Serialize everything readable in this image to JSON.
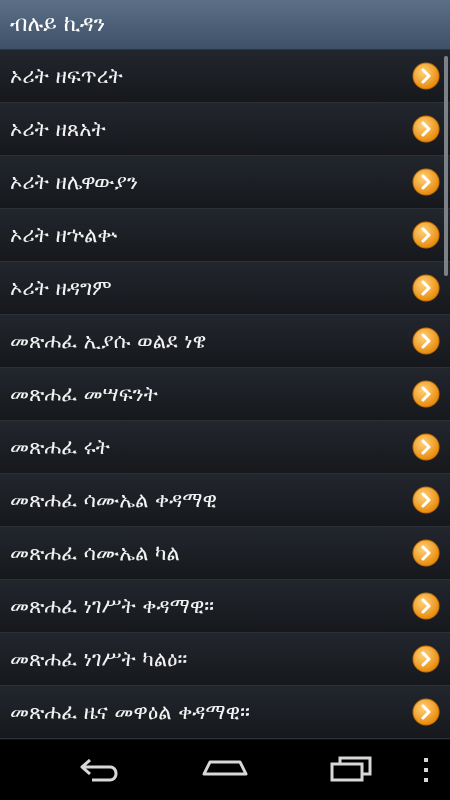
{
  "appbar": {
    "title": "ብሉይ ኪዳን"
  },
  "list": {
    "items": [
      "ኦሪት ዘፍጥረት",
      "ኦሪት ዘጸአት",
      "ኦሪት ዘሌዋውያን",
      "ኦሪት ዘኍልቍ",
      "ኦሪት ዘዳግም",
      "መጽሐፈ ኢያሱ ወልደ ነዌ",
      "መጽሐፈ መሣፍንት",
      "መጽሐፈ ሩት",
      "መጽሐፈ ሳሙኤል ቀዳማዊ",
      "መጽሐፈ ሳሙኤል ካል",
      "መጽሐፈ ነገሥት ቀዳማዊ።",
      "መጽሐፈ ነገሥት ካልዕ።",
      "መጽሐፈ ዜና መዋዕል ቀዳማዊ።"
    ],
    "item_icon": "chevron-right-icon"
  },
  "navbar": {
    "icons": [
      "back-icon",
      "home-icon",
      "recent-apps-icon",
      "overflow-menu-icon"
    ]
  },
  "colors": {
    "appbar": "#4a5d74",
    "row": "#1c1f24",
    "accent_orange": "#f7a21a",
    "text": "#f2f2f2"
  }
}
